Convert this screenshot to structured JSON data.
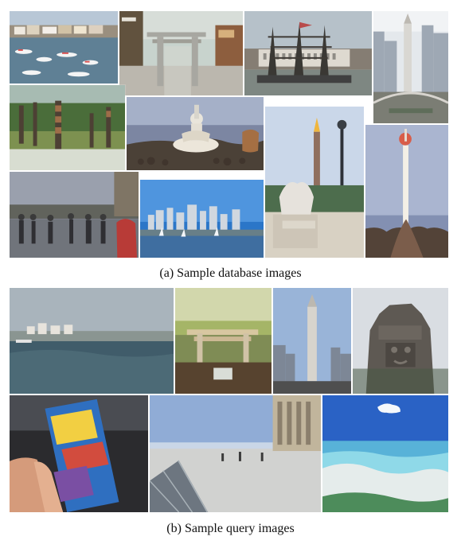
{
  "figure": {
    "database": {
      "caption": "(a) Sample database images",
      "tiles": [
        {
          "name": "harbor-boats-image",
          "icon": "harbor-icon"
        },
        {
          "name": "shrine-gate-image",
          "icon": "gate-icon"
        },
        {
          "name": "ship-museum-image",
          "icon": "ship-icon"
        },
        {
          "name": "obelisk-city-image",
          "icon": "obelisk-icon"
        },
        {
          "name": "totem-park-image",
          "icon": "totem-icon"
        },
        {
          "name": "shiva-statue-image",
          "icon": "statue-icon"
        },
        {
          "name": "concorde-obelisk-image",
          "icon": "obelisk-icon"
        },
        {
          "name": "tv-tower-image",
          "icon": "tower-icon"
        },
        {
          "name": "louvre-plaza-image",
          "icon": "plaza-icon"
        },
        {
          "name": "skyline-river-image",
          "icon": "skyline-icon"
        },
        {
          "name": "fountain-statue-image",
          "icon": "fountain-icon"
        }
      ]
    },
    "query": {
      "caption": "(b) Sample query images",
      "tiles": [
        {
          "name": "sea-coast-query-image",
          "icon": "sea-icon"
        },
        {
          "name": "torii-query-image",
          "icon": "gate-icon"
        },
        {
          "name": "obelisk-query-image",
          "icon": "obelisk-icon"
        },
        {
          "name": "stone-face-query-image",
          "icon": "temple-icon"
        },
        {
          "name": "guidebook-query-image",
          "icon": "book-icon"
        },
        {
          "name": "louvre-pyramid-query-image",
          "icon": "pyramid-icon"
        },
        {
          "name": "beach-query-image",
          "icon": "beach-icon"
        }
      ]
    }
  }
}
